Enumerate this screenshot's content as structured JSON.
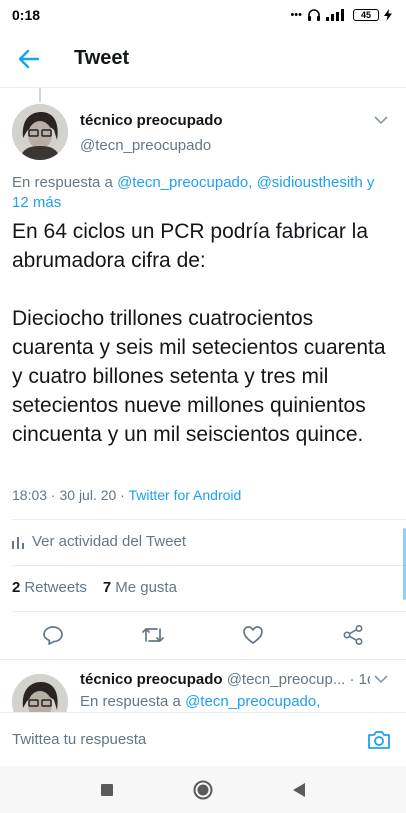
{
  "status": {
    "time": "0:18",
    "battery": "45"
  },
  "appbar": {
    "title": "Tweet"
  },
  "tweet": {
    "author_name": "técnico preocupado",
    "author_handle": "@tecn_preocupado",
    "reply_prefix": "En respuesta a ",
    "reply_links": "@tecn_preocupado, @sidiousthesith",
    "reply_suffix": " y 12 más",
    "text": "En 64 ciclos un PCR podría fabricar la abrumadora cifra de:\n\nDieciocho trillones cuatrocientos cuarenta y seis mil setecientos cuarenta y cuatro billones setenta y tres mil setecientos nueve millones quinientos cincuenta y un mil seiscientos quince.",
    "time": "18:03 · 30 jul. 20 · ",
    "app": "Twitter for Android",
    "activity_label": "Ver actividad del Tweet",
    "retweets_count": "2",
    "retweets_label": "Retweets",
    "likes_count": "7",
    "likes_label": "Me gusta"
  },
  "reply_tweet": {
    "author_name": "técnico preocupado",
    "handle_time": " @tecn_preocup... · 1d",
    "reply_prefix": "En respuesta a ",
    "reply_link": "@tecn_preocupado,"
  },
  "composer": {
    "placeholder": "Twittea tu respuesta"
  },
  "colors": {
    "accent": "#1da1f2",
    "secondary_text": "#657786",
    "divider": "#e6ecf0"
  },
  "icons": [
    "back-arrow-icon",
    "chevron-down-icon",
    "activity-icon",
    "reply-icon",
    "retweet-icon",
    "like-icon",
    "share-icon",
    "camera-icon",
    "nav-recents-icon",
    "nav-home-icon",
    "nav-back-icon"
  ]
}
